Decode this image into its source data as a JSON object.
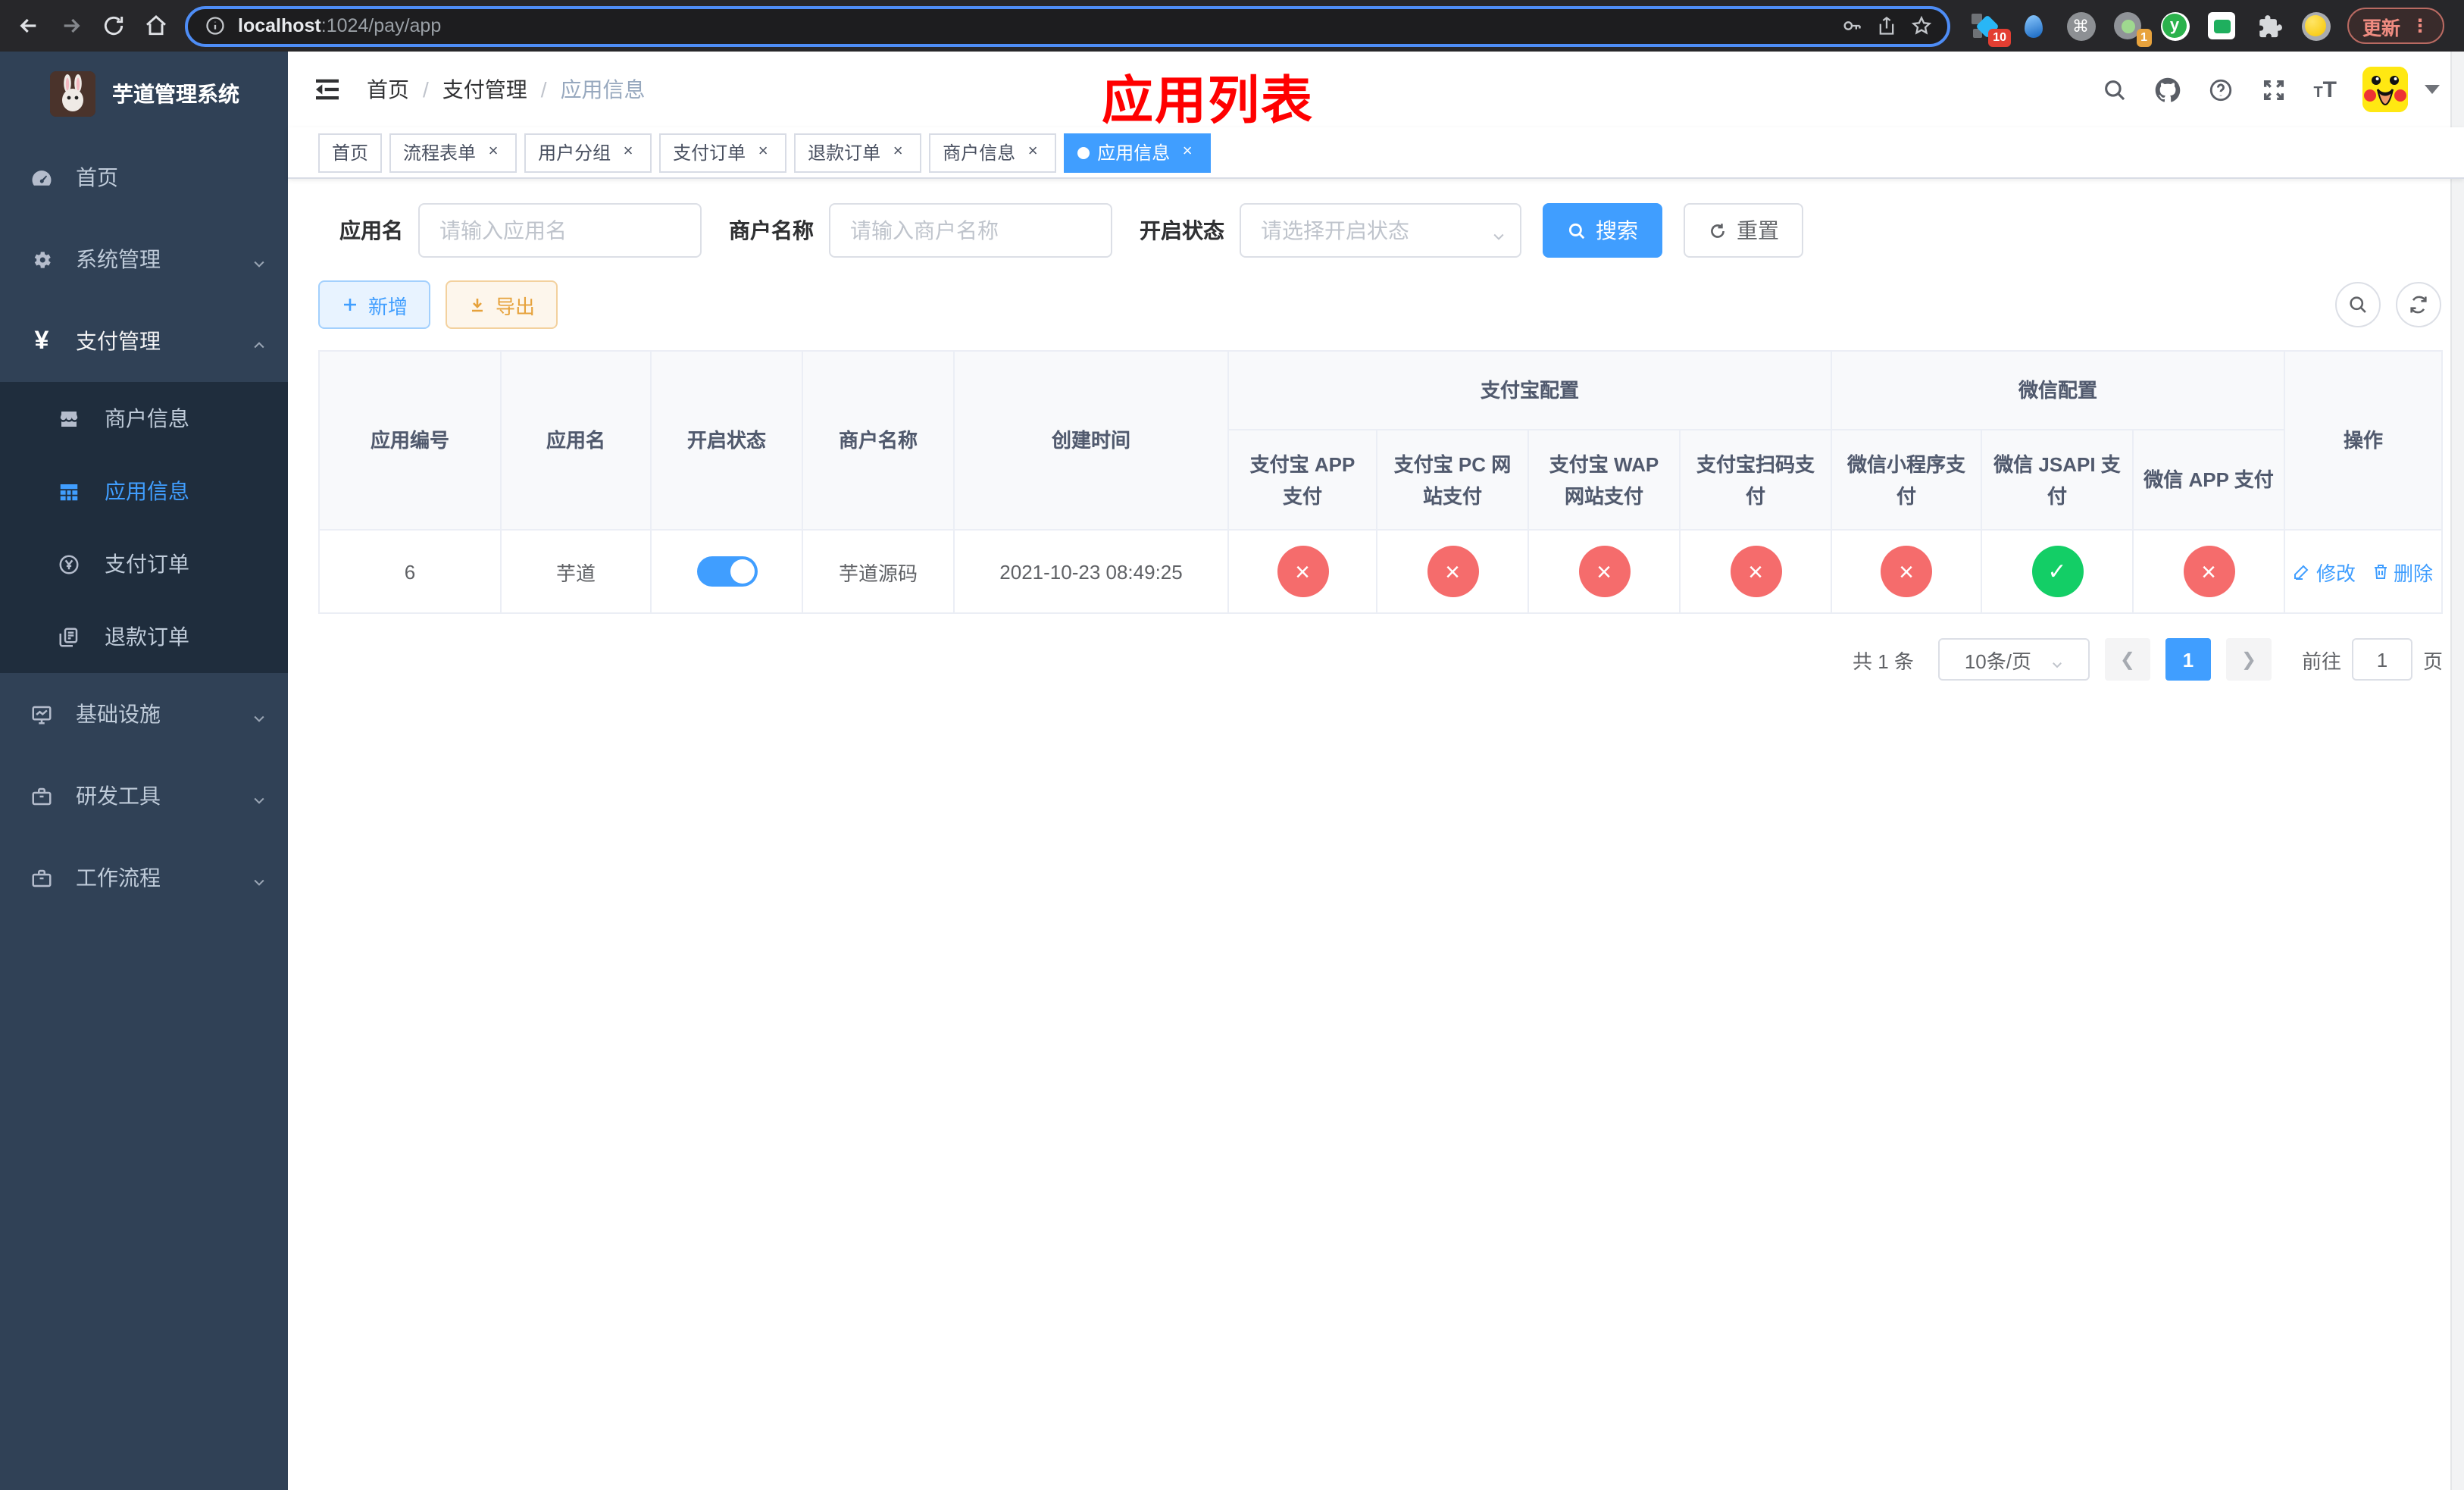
{
  "browser": {
    "url_host": "localhost",
    "url_path": ":1024/pay/app",
    "update_label": "更新",
    "ext_badge_a": "10",
    "ext_badge_b": "1",
    "ext_y_letter": "y"
  },
  "sidebar": {
    "app_title": "芋道管理系统",
    "items": {
      "home": "首页",
      "system": "系统管理",
      "payment": "支付管理",
      "merchant": "商户信息",
      "app_info": "应用信息",
      "pay_order": "支付订单",
      "refund_order": "退款订单",
      "infra": "基础设施",
      "dev_tools": "研发工具",
      "workflow": "工作流程"
    }
  },
  "navbar": {
    "breadcrumb": {
      "home": "首页",
      "section": "支付管理",
      "current": "应用信息"
    },
    "overlay_title": "应用列表",
    "font_icon_big": "T",
    "font_icon_small": "T"
  },
  "tabs": [
    {
      "label": "首页"
    },
    {
      "label": "流程表单"
    },
    {
      "label": "用户分组"
    },
    {
      "label": "支付订单"
    },
    {
      "label": "退款订单"
    },
    {
      "label": "商户信息"
    },
    {
      "label": "应用信息"
    }
  ],
  "filters": {
    "app_name_label": "应用名",
    "app_name_placeholder": "请输入应用名",
    "merchant_label": "商户名称",
    "merchant_placeholder": "请输入商户名称",
    "status_label": "开启状态",
    "status_placeholder": "请选择开启状态",
    "search_label": "搜索",
    "reset_label": "重置"
  },
  "toolbar": {
    "add_label": "新增",
    "export_label": "导出"
  },
  "table": {
    "headers": {
      "app_id": "应用编号",
      "app_name": "应用名",
      "status": "开启状态",
      "merchant": "商户名称",
      "created": "创建时间",
      "alipay_group": "支付宝配置",
      "wechat_group": "微信配置",
      "action": "操作"
    },
    "sub_headers": [
      "支付宝 APP 支付",
      "支付宝 PC 网站支付",
      "支付宝 WAP 网站支付",
      "支付宝扫码支付",
      "微信小程序支付",
      "微信 JSAPI 支付",
      "微信 APP 支付"
    ],
    "row": {
      "app_id": "6",
      "app_name": "芋道",
      "merchant": "芋道源码",
      "created": "2021-10-23 08:49:25",
      "statuses": [
        "no",
        "no",
        "no",
        "no",
        "no",
        "yes",
        "no"
      ],
      "edit_label": "修改",
      "delete_label": "删除"
    }
  },
  "pagination": {
    "total_text": "共 1 条",
    "page_size_text": "10条/页",
    "current_page": "1",
    "goto_label": "前往",
    "goto_value": "1",
    "page_unit": "页"
  },
  "colors": {
    "primary": "#409eff",
    "danger": "#f56c6c",
    "success": "#13ce66",
    "title_red": "#ff0000"
  }
}
